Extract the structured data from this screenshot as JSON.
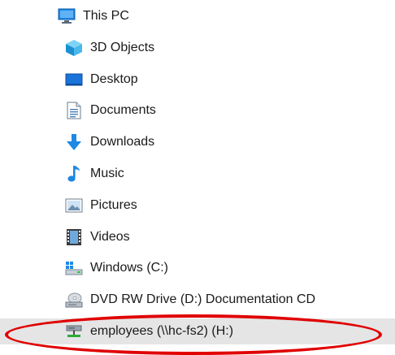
{
  "tree": {
    "root": {
      "label": "This PC",
      "icon": "this-pc-icon"
    },
    "items": [
      {
        "label": "3D Objects",
        "icon": "3d-objects-icon"
      },
      {
        "label": "Desktop",
        "icon": "desktop-icon"
      },
      {
        "label": "Documents",
        "icon": "documents-icon"
      },
      {
        "label": "Downloads",
        "icon": "downloads-icon"
      },
      {
        "label": "Music",
        "icon": "music-icon"
      },
      {
        "label": "Pictures",
        "icon": "pictures-icon"
      },
      {
        "label": "Videos",
        "icon": "videos-icon"
      },
      {
        "label": "Windows (C:)",
        "icon": "windows-drive-icon"
      },
      {
        "label": "DVD RW Drive (D:) Documentation CD",
        "icon": "dvd-drive-icon"
      },
      {
        "label": "employees (\\\\hc-fs2) (H:)",
        "icon": "network-drive-icon",
        "selected": true
      }
    ]
  },
  "colors": {
    "selected_background": "#e5e5e5",
    "highlight_ring": "#e00000",
    "folder_blue": "#1e88e5"
  }
}
